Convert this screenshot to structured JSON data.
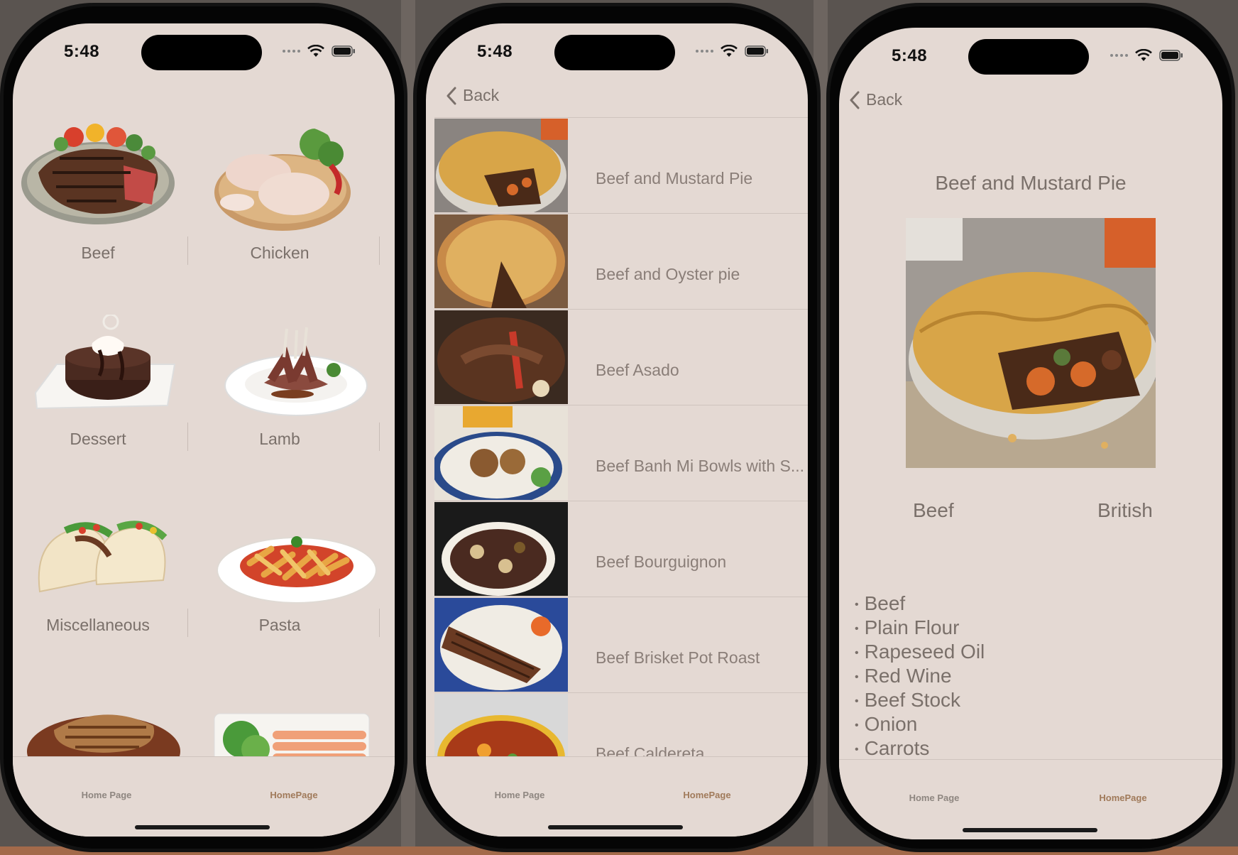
{
  "status_bar": {
    "time": "5:48"
  },
  "tabbar": {
    "tab1": "Home Page",
    "tab2": "HomePage"
  },
  "nav": {
    "back": "Back"
  },
  "categories": [
    {
      "label": "Beef"
    },
    {
      "label": "Chicken"
    },
    {
      "label": "Dessert"
    },
    {
      "label": "Lamb"
    },
    {
      "label": "Miscellaneous"
    },
    {
      "label": "Pasta"
    },
    {
      "label": ""
    },
    {
      "label": ""
    }
  ],
  "meals": [
    {
      "label": "Beef and Mustard Pie"
    },
    {
      "label": "Beef and Oyster pie"
    },
    {
      "label": "Beef Asado"
    },
    {
      "label": "Beef Banh Mi Bowls with S..."
    },
    {
      "label": "Beef Bourguignon"
    },
    {
      "label": "Beef Brisket Pot Roast"
    },
    {
      "label": "Beef Caldereta"
    }
  ],
  "detail": {
    "title": "Beef and Mustard Pie",
    "category": "Beef",
    "area": "British",
    "ingredients": [
      "Beef",
      "Plain Flour",
      "Rapeseed Oil",
      "Red Wine",
      "Beef Stock",
      "Onion",
      "Carrots"
    ]
  },
  "colors": {
    "background": "#e4d9d3",
    "text": "#7a706a",
    "active_tab": "#a07a5a"
  }
}
